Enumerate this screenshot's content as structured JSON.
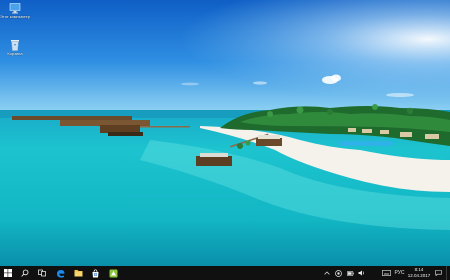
{
  "desktop": {
    "icons": [
      {
        "label": "Этот компьютер",
        "icon": "this-pc-icon"
      },
      {
        "label": "Корзина",
        "icon": "recycle-bin-icon"
      }
    ]
  },
  "taskbar": {
    "start_icon": "windows-logo-icon",
    "pinned": [
      "search-icon",
      "task-view-icon",
      "edge-browser-icon",
      "file-explorer-icon",
      "store-icon",
      "app-icon"
    ],
    "tray": {
      "icons": [
        "chevron-up-icon",
        "network-icon",
        "battery-icon",
        "volume-icon",
        "keyboard-icon"
      ],
      "language": "РУС",
      "time": "8:14",
      "date": "12.04.2017",
      "notification_icon": "action-center-icon"
    }
  },
  "colors": {
    "taskbar": "#101010",
    "accent": "#1a73d9",
    "sky_top": "#1166c8",
    "lagoon": "#1fc9d0"
  }
}
